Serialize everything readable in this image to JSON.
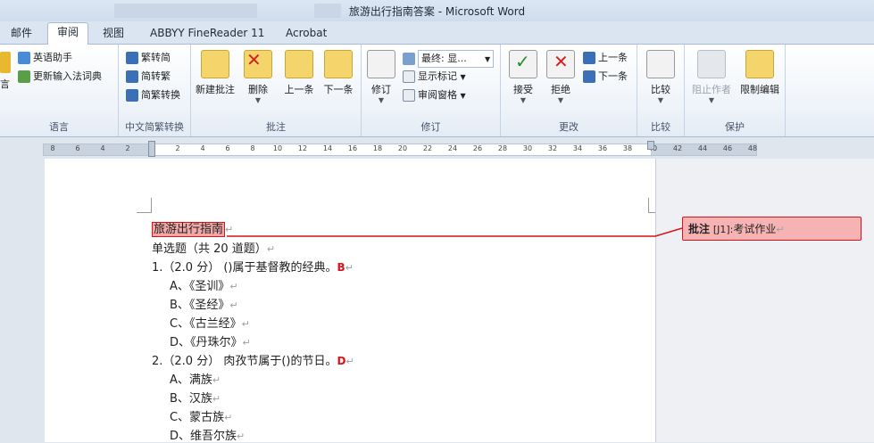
{
  "window": {
    "title": "旅游出行指南答案 - Microsoft Word"
  },
  "tabs": [
    {
      "label": "邮件",
      "active": false
    },
    {
      "label": "审阅",
      "active": true
    },
    {
      "label": "视图",
      "active": false
    },
    {
      "label": "ABBYY FineReader 11",
      "active": false
    },
    {
      "label": "Acrobat",
      "active": false
    }
  ],
  "ribbon": {
    "language": {
      "label": "语言",
      "left_partial": "言",
      "english_assistant": "英语助手",
      "update_ime": "更新输入法词典"
    },
    "chinese_conversion": {
      "label": "中文简繁转换",
      "to_traditional": "繁转简",
      "to_simplified_trad": "简转繁",
      "convert": "简繁转换"
    },
    "comments": {
      "label": "批注",
      "new": "新建批注",
      "delete": "删除",
      "previous": "上一条",
      "next": "下一条"
    },
    "tracking": {
      "label": "修订",
      "track_changes": "修订",
      "final_display": "最终: 显...",
      "show_markup": "显示标记",
      "reviewing_pane": "审阅窗格"
    },
    "changes": {
      "label": "更改",
      "accept": "接受",
      "reject": "拒绝",
      "previous": "上一条",
      "next": "下一条"
    },
    "compare": {
      "label": "比较",
      "compare": "比较"
    },
    "protect": {
      "label": "保护",
      "block_authors": "阻止作者",
      "restrict_editing": "限制编辑"
    }
  },
  "ruler": {
    "ticks": [
      "8",
      "6",
      "4",
      "2",
      "",
      "2",
      "4",
      "6",
      "8",
      "10",
      "12",
      "14",
      "16",
      "18",
      "20",
      "22",
      "24",
      "26",
      "28",
      "30",
      "32",
      "34",
      "36",
      "38",
      "40",
      "42",
      "44",
      "46",
      "48"
    ]
  },
  "document": {
    "title_line": "旅游出行指南",
    "section": "单选题（共 20 道题）",
    "questions": [
      {
        "stem": "1.（2.0 分）  ()属于基督教的经典。",
        "answer": "B",
        "options": [
          "A、《圣训》",
          "B、《圣经》",
          "C、《古兰经》",
          "D、《丹珠尔》"
        ]
      },
      {
        "stem": "2.（2.0 分）  肉孜节属于()的节日。",
        "answer": "D",
        "options": [
          "A、满族",
          "B、汉族",
          "C、蒙古族",
          "D、维吾尔族"
        ]
      }
    ],
    "para_mark": "↵"
  },
  "comment": {
    "label": "批注",
    "id": "[J1]:",
    "text": "考试作业"
  },
  "colors": {
    "comment_fill": "#f7b3b3",
    "comment_border": "#d7141a",
    "answer": "#d7141a"
  }
}
